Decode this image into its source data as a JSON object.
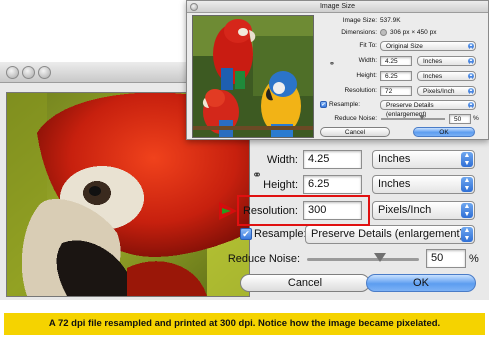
{
  "small_dialog": {
    "title": "Image Size",
    "image_size_label": "Image Size:",
    "image_size_value": "537.9K",
    "dimensions_label": "Dimensions:",
    "dimensions_value": "306 px × 450 px",
    "fit_to_label": "Fit To:",
    "fit_to_value": "Original Size",
    "width_label": "Width:",
    "width_value": "4.25",
    "width_unit": "Inches",
    "height_label": "Height:",
    "height_value": "6.25",
    "height_unit": "Inches",
    "resolution_label": "Resolution:",
    "resolution_value": "72",
    "resolution_unit": "Pixels/Inch",
    "resample_label": "Resample:",
    "resample_value": "Preserve Details (enlargement)",
    "reduce_noise_label": "Reduce Noise:",
    "reduce_noise_value": "50",
    "reduce_noise_unit": "%",
    "cancel_label": "Cancel",
    "ok_label": "OK"
  },
  "large_dialog": {
    "width_label": "Width:",
    "width_value": "4.25",
    "width_unit": "Inches",
    "height_label": "Height:",
    "height_value": "6.25",
    "height_unit": "Inches",
    "resolution_label": "Resolution:",
    "resolution_value": "300",
    "resolution_unit": "Pixels/Inch",
    "resample_label": "Resample:",
    "resample_value": "Preserve Details (enlargement)",
    "reduce_noise_label": "Reduce Noise:",
    "reduce_noise_value": "50",
    "reduce_noise_unit": "%",
    "cancel_label": "Cancel",
    "ok_label": "OK"
  },
  "controls": {
    "resample_checked": true,
    "reduce_noise_slider_fraction": 0.5
  },
  "icons": {
    "link": "chain-link-icon",
    "arrow": "red-green-arrow-icon",
    "dropdown": "up-down-arrows-icon"
  },
  "colors": {
    "caption_bg": "#f5d300",
    "highlight": "#e01010",
    "ok_button": "#5d9df0"
  },
  "caption": "A 72 dpi file resampled and printed at 300 dpi. Notice how the image became pixelated."
}
